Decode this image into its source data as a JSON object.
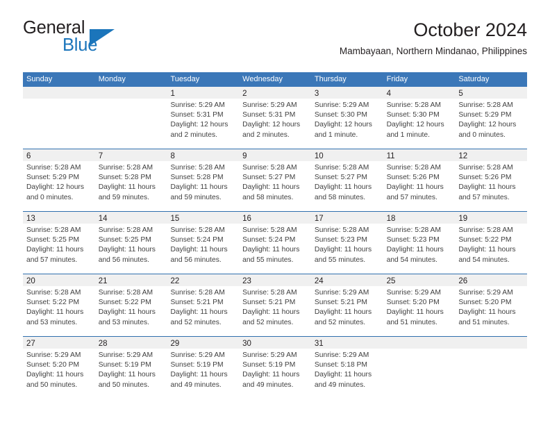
{
  "brand": {
    "word_one": "General",
    "word_two": "Blue",
    "accent_color": "#1b75bb",
    "logo_icon": "triangle-icon"
  },
  "header": {
    "title": "October 2024",
    "subtitle": "Mambayaan, Northern Mindanao, Philippines"
  },
  "theme": {
    "header_blue": "#3b77b8",
    "row_divider": "#2f6fae",
    "date_band": "#f0f0f0",
    "text": "#231f20"
  },
  "weekdays": [
    "Sunday",
    "Monday",
    "Tuesday",
    "Wednesday",
    "Thursday",
    "Friday",
    "Saturday"
  ],
  "weeks": [
    [
      {
        "day": "",
        "empty": true
      },
      {
        "day": "",
        "empty": true
      },
      {
        "day": "1",
        "sunrise": "Sunrise: 5:29 AM",
        "sunset": "Sunset: 5:31 PM",
        "daylight_1": "Daylight: 12 hours",
        "daylight_2": "and 2 minutes."
      },
      {
        "day": "2",
        "sunrise": "Sunrise: 5:29 AM",
        "sunset": "Sunset: 5:31 PM",
        "daylight_1": "Daylight: 12 hours",
        "daylight_2": "and 2 minutes."
      },
      {
        "day": "3",
        "sunrise": "Sunrise: 5:29 AM",
        "sunset": "Sunset: 5:30 PM",
        "daylight_1": "Daylight: 12 hours",
        "daylight_2": "and 1 minute."
      },
      {
        "day": "4",
        "sunrise": "Sunrise: 5:28 AM",
        "sunset": "Sunset: 5:30 PM",
        "daylight_1": "Daylight: 12 hours",
        "daylight_2": "and 1 minute."
      },
      {
        "day": "5",
        "sunrise": "Sunrise: 5:28 AM",
        "sunset": "Sunset: 5:29 PM",
        "daylight_1": "Daylight: 12 hours",
        "daylight_2": "and 0 minutes."
      }
    ],
    [
      {
        "day": "6",
        "sunrise": "Sunrise: 5:28 AM",
        "sunset": "Sunset: 5:29 PM",
        "daylight_1": "Daylight: 12 hours",
        "daylight_2": "and 0 minutes."
      },
      {
        "day": "7",
        "sunrise": "Sunrise: 5:28 AM",
        "sunset": "Sunset: 5:28 PM",
        "daylight_1": "Daylight: 11 hours",
        "daylight_2": "and 59 minutes."
      },
      {
        "day": "8",
        "sunrise": "Sunrise: 5:28 AM",
        "sunset": "Sunset: 5:28 PM",
        "daylight_1": "Daylight: 11 hours",
        "daylight_2": "and 59 minutes."
      },
      {
        "day": "9",
        "sunrise": "Sunrise: 5:28 AM",
        "sunset": "Sunset: 5:27 PM",
        "daylight_1": "Daylight: 11 hours",
        "daylight_2": "and 58 minutes."
      },
      {
        "day": "10",
        "sunrise": "Sunrise: 5:28 AM",
        "sunset": "Sunset: 5:27 PM",
        "daylight_1": "Daylight: 11 hours",
        "daylight_2": "and 58 minutes."
      },
      {
        "day": "11",
        "sunrise": "Sunrise: 5:28 AM",
        "sunset": "Sunset: 5:26 PM",
        "daylight_1": "Daylight: 11 hours",
        "daylight_2": "and 57 minutes."
      },
      {
        "day": "12",
        "sunrise": "Sunrise: 5:28 AM",
        "sunset": "Sunset: 5:26 PM",
        "daylight_1": "Daylight: 11 hours",
        "daylight_2": "and 57 minutes."
      }
    ],
    [
      {
        "day": "13",
        "sunrise": "Sunrise: 5:28 AM",
        "sunset": "Sunset: 5:25 PM",
        "daylight_1": "Daylight: 11 hours",
        "daylight_2": "and 57 minutes."
      },
      {
        "day": "14",
        "sunrise": "Sunrise: 5:28 AM",
        "sunset": "Sunset: 5:25 PM",
        "daylight_1": "Daylight: 11 hours",
        "daylight_2": "and 56 minutes."
      },
      {
        "day": "15",
        "sunrise": "Sunrise: 5:28 AM",
        "sunset": "Sunset: 5:24 PM",
        "daylight_1": "Daylight: 11 hours",
        "daylight_2": "and 56 minutes."
      },
      {
        "day": "16",
        "sunrise": "Sunrise: 5:28 AM",
        "sunset": "Sunset: 5:24 PM",
        "daylight_1": "Daylight: 11 hours",
        "daylight_2": "and 55 minutes."
      },
      {
        "day": "17",
        "sunrise": "Sunrise: 5:28 AM",
        "sunset": "Sunset: 5:23 PM",
        "daylight_1": "Daylight: 11 hours",
        "daylight_2": "and 55 minutes."
      },
      {
        "day": "18",
        "sunrise": "Sunrise: 5:28 AM",
        "sunset": "Sunset: 5:23 PM",
        "daylight_1": "Daylight: 11 hours",
        "daylight_2": "and 54 minutes."
      },
      {
        "day": "19",
        "sunrise": "Sunrise: 5:28 AM",
        "sunset": "Sunset: 5:22 PM",
        "daylight_1": "Daylight: 11 hours",
        "daylight_2": "and 54 minutes."
      }
    ],
    [
      {
        "day": "20",
        "sunrise": "Sunrise: 5:28 AM",
        "sunset": "Sunset: 5:22 PM",
        "daylight_1": "Daylight: 11 hours",
        "daylight_2": "and 53 minutes."
      },
      {
        "day": "21",
        "sunrise": "Sunrise: 5:28 AM",
        "sunset": "Sunset: 5:22 PM",
        "daylight_1": "Daylight: 11 hours",
        "daylight_2": "and 53 minutes."
      },
      {
        "day": "22",
        "sunrise": "Sunrise: 5:28 AM",
        "sunset": "Sunset: 5:21 PM",
        "daylight_1": "Daylight: 11 hours",
        "daylight_2": "and 52 minutes."
      },
      {
        "day": "23",
        "sunrise": "Sunrise: 5:28 AM",
        "sunset": "Sunset: 5:21 PM",
        "daylight_1": "Daylight: 11 hours",
        "daylight_2": "and 52 minutes."
      },
      {
        "day": "24",
        "sunrise": "Sunrise: 5:29 AM",
        "sunset": "Sunset: 5:21 PM",
        "daylight_1": "Daylight: 11 hours",
        "daylight_2": "and 52 minutes."
      },
      {
        "day": "25",
        "sunrise": "Sunrise: 5:29 AM",
        "sunset": "Sunset: 5:20 PM",
        "daylight_1": "Daylight: 11 hours",
        "daylight_2": "and 51 minutes."
      },
      {
        "day": "26",
        "sunrise": "Sunrise: 5:29 AM",
        "sunset": "Sunset: 5:20 PM",
        "daylight_1": "Daylight: 11 hours",
        "daylight_2": "and 51 minutes."
      }
    ],
    [
      {
        "day": "27",
        "sunrise": "Sunrise: 5:29 AM",
        "sunset": "Sunset: 5:20 PM",
        "daylight_1": "Daylight: 11 hours",
        "daylight_2": "and 50 minutes."
      },
      {
        "day": "28",
        "sunrise": "Sunrise: 5:29 AM",
        "sunset": "Sunset: 5:19 PM",
        "daylight_1": "Daylight: 11 hours",
        "daylight_2": "and 50 minutes."
      },
      {
        "day": "29",
        "sunrise": "Sunrise: 5:29 AM",
        "sunset": "Sunset: 5:19 PM",
        "daylight_1": "Daylight: 11 hours",
        "daylight_2": "and 49 minutes."
      },
      {
        "day": "30",
        "sunrise": "Sunrise: 5:29 AM",
        "sunset": "Sunset: 5:19 PM",
        "daylight_1": "Daylight: 11 hours",
        "daylight_2": "and 49 minutes."
      },
      {
        "day": "31",
        "sunrise": "Sunrise: 5:29 AM",
        "sunset": "Sunset: 5:18 PM",
        "daylight_1": "Daylight: 11 hours",
        "daylight_2": "and 49 minutes."
      },
      {
        "day": "",
        "empty": true
      },
      {
        "day": "",
        "empty": true
      }
    ]
  ]
}
